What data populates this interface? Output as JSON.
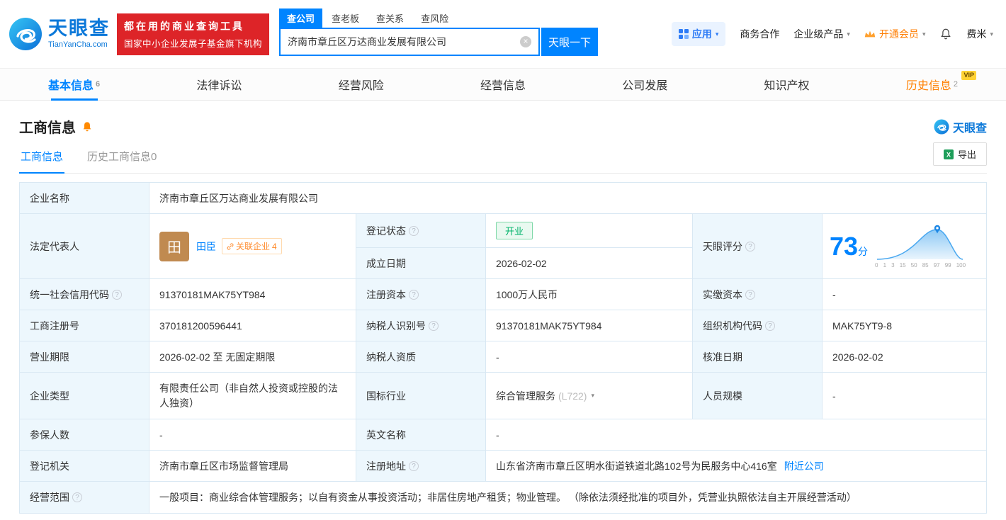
{
  "icons": {
    "help": "?",
    "caret": "▾",
    "clear": "×"
  },
  "header": {
    "logo": {
      "title": "天眼查",
      "subtitle": "TianYanCha.com"
    },
    "promo": {
      "line1": "都在用的商业查询工具",
      "line2": "国家中小企业发展子基金旗下机构"
    },
    "search": {
      "tabs": [
        {
          "label": "查公司"
        },
        {
          "label": "查老板"
        },
        {
          "label": "查关系"
        },
        {
          "label": "查风险"
        }
      ],
      "value": "济南市章丘区万达商业发展有限公司",
      "button": "天眼一下"
    },
    "nav": {
      "apps": "应用",
      "cooperation": "商务合作",
      "enterprise": "企业级产品",
      "vip": "开通会员",
      "user": "费米"
    }
  },
  "main_tabs": [
    {
      "label": "基本信息",
      "count": "6"
    },
    {
      "label": "法律诉讼",
      "count": ""
    },
    {
      "label": "经营风险",
      "count": ""
    },
    {
      "label": "经营信息",
      "count": ""
    },
    {
      "label": "公司发展",
      "count": ""
    },
    {
      "label": "知识产权",
      "count": ""
    },
    {
      "label": "历史信息",
      "count": "2",
      "vip_badge": "VIP"
    }
  ],
  "section": {
    "title": "工商信息",
    "watermark": "天眼查",
    "subtab_active": "工商信息",
    "subtab_history": "历史工商信息0",
    "export": "导出"
  },
  "info": {
    "company_name_label": "企业名称",
    "company_name": "济南市章丘区万达商业发展有限公司",
    "legal_rep_label": "法定代表人",
    "avatar_char": "田",
    "legal_rep": "田臣",
    "related_companies": "关联企业",
    "related_count": "4",
    "reg_status_label": "登记状态",
    "reg_status": "开业",
    "est_date_label": "成立日期",
    "est_date": "2026-02-02",
    "score_label": "天眼评分",
    "score": "73",
    "score_unit": "分",
    "credit_code_label": "统一社会信用代码",
    "credit_code": "91370181MAK75YT984",
    "reg_capital_label": "注册资本",
    "reg_capital": "1000万人民币",
    "paid_capital_label": "实缴资本",
    "paid_capital": "-",
    "reg_no_label": "工商注册号",
    "reg_no": "370181200596441",
    "taxpayer_id_label": "纳税人识别号",
    "taxpayer_id": "91370181MAK75YT984",
    "org_code_label": "组织机构代码",
    "org_code": "MAK75YT9-8",
    "term_label": "营业期限",
    "term": "2026-02-02 至 无固定期限",
    "taxpayer_qual_label": "纳税人资质",
    "taxpayer_qual": "-",
    "approval_date_label": "核准日期",
    "approval_date": "2026-02-02",
    "type_label": "企业类型",
    "type": "有限责任公司（非自然人投资或控股的法人独资）",
    "industry_label": "国标行业",
    "industry": "综合管理服务",
    "industry_code": "(L722)",
    "staff_label": "人员规模",
    "staff": "-",
    "insured_label": "参保人数",
    "insured": "-",
    "en_name_label": "英文名称",
    "en_name": "-",
    "authority_label": "登记机关",
    "authority": "济南市章丘区市场监督管理局",
    "address_label": "注册地址",
    "address": "山东省济南市章丘区明水街道铁道北路102号为民服务中心416室",
    "nearby": "附近公司",
    "scope_label": "经营范围",
    "scope": "一般项目：商业综合体管理服务；以自有资金从事投资活动；非居住房地产租赁；物业管理。 （除依法须经批准的项目外，凭营业执照依法自主开展经营活动）"
  },
  "chart_axis": [
    "0",
    "1",
    "3",
    "15",
    "50",
    "85",
    "97",
    "99",
    "100"
  ],
  "colors": {
    "brand_blue": "#0084ff",
    "promo_red": "#dd2428",
    "vip_orange": "#ff8000",
    "status_green": "#00b26a",
    "label_bg": "#edf7fd"
  }
}
